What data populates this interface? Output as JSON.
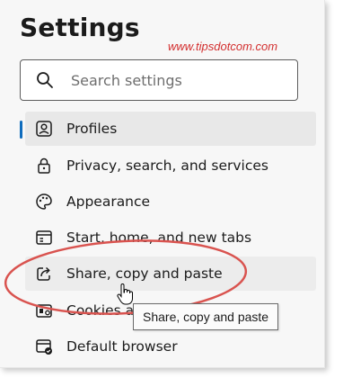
{
  "title": "Settings",
  "watermark": "www.tipsdotcom.com",
  "search": {
    "placeholder": "Search settings"
  },
  "nav": {
    "items": [
      {
        "label": "Profiles",
        "icon": "profile-icon",
        "selected": true
      },
      {
        "label": "Privacy, search, and services",
        "icon": "lock-icon"
      },
      {
        "label": "Appearance",
        "icon": "palette-icon"
      },
      {
        "label": "Start, home, and new tabs",
        "icon": "home-tabs-icon"
      },
      {
        "label": "Share, copy and paste",
        "icon": "share-icon",
        "hovered": true
      },
      {
        "label": "Cookies a",
        "icon": "cookies-icon"
      },
      {
        "label": "Default browser",
        "icon": "default-browser-icon"
      }
    ]
  },
  "tooltip": {
    "text": "Share, copy and paste"
  },
  "colors": {
    "accent": "#0f6cbd",
    "annotation_red": "#d32f2f",
    "panel_bg": "#f7f7f7",
    "selected_bg": "#e8e8e8"
  }
}
